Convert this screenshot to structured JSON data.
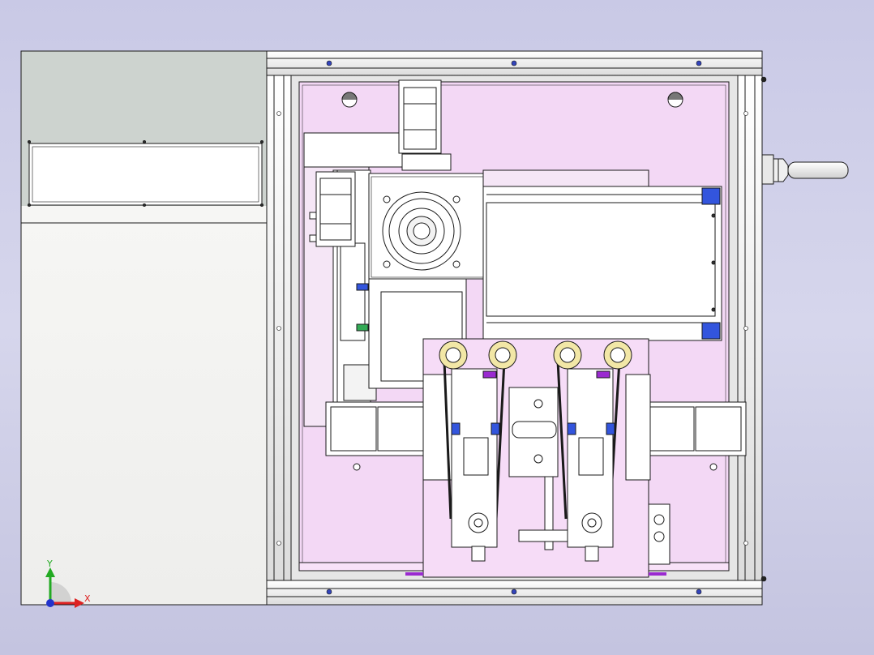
{
  "viewport": {
    "background_top": "#c9c9e6",
    "background_bottom": "#c4c4e0"
  },
  "colors": {
    "outline": "#1a1a1a",
    "left_panel_top": "#cdd3cf",
    "left_panel_bottom": "#f4f4f2",
    "enclosure": "#e4e4e4",
    "work_plate": "#f3d8f5",
    "base_plate": "#f6dcf7",
    "part_white": "#ffffff",
    "accent_blue": "#3355dd",
    "accent_purple": "#9a2ad0",
    "pulley_yellow": "#f2e7a6"
  },
  "triad": {
    "x_label": "X",
    "y_label": "Y",
    "x_color": "#dd2222",
    "y_color": "#22aa22",
    "origin_color": "#2233cc"
  }
}
